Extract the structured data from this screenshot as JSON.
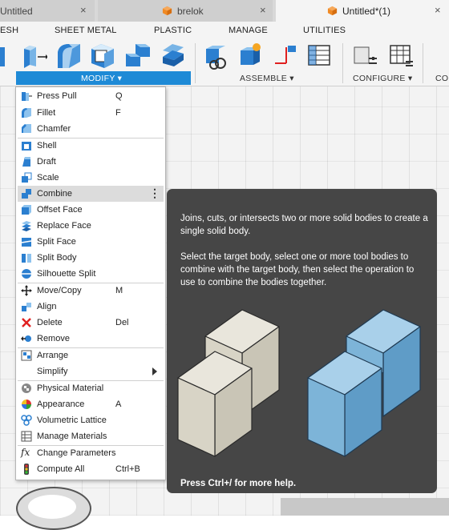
{
  "doc_tabs": [
    {
      "label": "Untitled",
      "close": "×"
    },
    {
      "label": "brelok",
      "close": "×"
    },
    {
      "label": "Untitled*(1)",
      "close": "×"
    }
  ],
  "workspace_tabs": [
    "ESH",
    "SHEET METAL",
    "PLASTIC",
    "MANAGE",
    "UTILITIES"
  ],
  "ribbon": {
    "modify_label": "MODIFY ▾",
    "assemble_label": "ASSEMBLE ▾",
    "configure_label": "CONFIGURE ▾",
    "more_label": "CO"
  },
  "menu": {
    "items": [
      {
        "label": "Press Pull",
        "key": "Q"
      },
      {
        "label": "Fillet",
        "key": "F"
      },
      {
        "label": "Chamfer",
        "key": ""
      },
      {
        "label": "Shell",
        "key": ""
      },
      {
        "label": "Draft",
        "key": ""
      },
      {
        "label": "Scale",
        "key": ""
      },
      {
        "label": "Combine",
        "key": ""
      },
      {
        "label": "Offset Face",
        "key": ""
      },
      {
        "label": "Replace Face",
        "key": ""
      },
      {
        "label": "Split Face",
        "key": ""
      },
      {
        "label": "Split Body",
        "key": ""
      },
      {
        "label": "Silhouette Split",
        "key": ""
      },
      {
        "label": "Move/Copy",
        "key": "M"
      },
      {
        "label": "Align",
        "key": ""
      },
      {
        "label": "Delete",
        "key": "Del"
      },
      {
        "label": "Remove",
        "key": ""
      },
      {
        "label": "Arrange",
        "key": ""
      },
      {
        "label": "Simplify",
        "key": ""
      },
      {
        "label": "Physical Material",
        "key": ""
      },
      {
        "label": "Appearance",
        "key": "A"
      },
      {
        "label": "Volumetric Lattice",
        "key": ""
      },
      {
        "label": "Manage Materials",
        "key": ""
      },
      {
        "label": "Change Parameters",
        "key": ""
      },
      {
        "label": "Compute All",
        "key": "Ctrl+B"
      }
    ],
    "more_glyph": "⋮"
  },
  "tooltip": {
    "line1": "Joins, cuts, or intersects two or more solid bodies to create a single solid body.",
    "line2": "Select the target body, select one or more tool bodies to combine with the target body, then select the operation to use to combine the bodies together.",
    "footer": "Press Ctrl+/ for more help."
  },
  "colors": {
    "accent": "#1e8ad6",
    "tooltip_bg": "#464646",
    "cube_beige": "#d6d2c4",
    "cube_blue": "#7db4d8"
  }
}
